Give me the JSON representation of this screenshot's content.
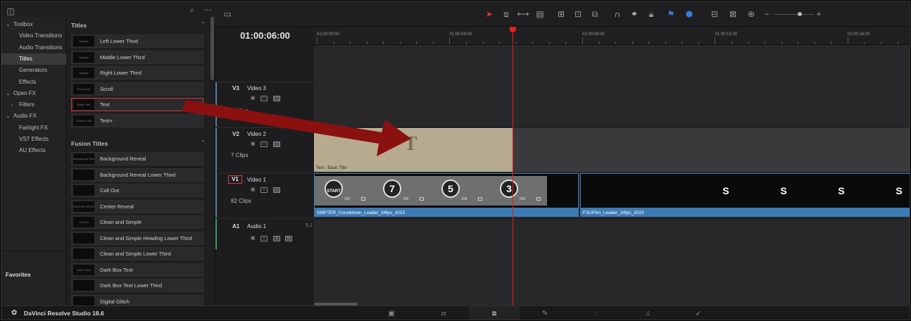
{
  "app": {
    "name": "DaVinci Resolve Studio 18.6",
    "accent": "#e03030"
  },
  "sidebar": {
    "items": [
      {
        "label": "Toolbox",
        "caret": "v",
        "indent": 0
      },
      {
        "label": "Video Transitions",
        "caret": "",
        "indent": 1
      },
      {
        "label": "Audio Transitions",
        "caret": "",
        "indent": 1
      },
      {
        "label": "Titles",
        "caret": "",
        "indent": 1,
        "selected": true
      },
      {
        "label": "Generators",
        "caret": "",
        "indent": 1
      },
      {
        "label": "Effects",
        "caret": "",
        "indent": 1
      },
      {
        "label": "Open FX",
        "caret": "v",
        "indent": 0
      },
      {
        "label": "Filters",
        "caret": ">",
        "indent": 1
      },
      {
        "label": "Audio FX",
        "caret": "v",
        "indent": 0
      },
      {
        "label": "Fairlight FX",
        "caret": "",
        "indent": 1
      },
      {
        "label": "VST Effects",
        "caret": "",
        "indent": 1
      },
      {
        "label": "AU Effects",
        "caret": "",
        "indent": 1
      }
    ],
    "favorites": "Favorites"
  },
  "effects_panel": {
    "titles_header": "Titles",
    "titles": [
      {
        "label": "Left Lower Third",
        "thumb": "Sample"
      },
      {
        "label": "Middle Lower Third",
        "thumb": "Sample"
      },
      {
        "label": "Right Lower Third",
        "thumb": "Sample"
      },
      {
        "label": "Scroll",
        "thumb": "Scroll Line"
      },
      {
        "label": "Text",
        "thumb": "Basic Title",
        "highlighted": true
      },
      {
        "label": "Text+",
        "thumb": "Custom Title"
      }
    ],
    "fusion_header": "Fusion Titles",
    "fusion": [
      {
        "label": "Background Reveal",
        "thumb": "Background Reveal"
      },
      {
        "label": "Background Reveal Lower Third",
        "thumb": ""
      },
      {
        "label": "Call Out",
        "thumb": ""
      },
      {
        "label": "Center Reveal",
        "thumb": "CENTER REVEAL"
      },
      {
        "label": "Clean and Simple",
        "thumb": "CLEAN"
      },
      {
        "label": "Clean and Simple Heading Lower Third",
        "thumb": ""
      },
      {
        "label": "Clean and Simple Lower Third",
        "thumb": ""
      },
      {
        "label": "Dark Box Text",
        "thumb": "DARK BOX"
      },
      {
        "label": "Dark Box Text Lower Third",
        "thumb": ""
      },
      {
        "label": "Digital Glitch",
        "thumb": ""
      }
    ]
  },
  "timeline": {
    "timecode": "01:00:06:00",
    "ruler": [
      "01:00:00:00",
      "01:00:04:00",
      "01:00:08:00",
      "01:00:12:00",
      "01:00:16:00"
    ],
    "tracks": [
      {
        "id": "V3",
        "name": "Video 3",
        "clips": "0 Clips"
      },
      {
        "id": "V2",
        "name": "Video 2",
        "clips": "7 Clips"
      },
      {
        "id": "V1",
        "name": "Video 1",
        "clips": "82 Clips"
      },
      {
        "id": "A1",
        "name": "Audio 1",
        "channels": "5.1"
      }
    ],
    "title_clip": {
      "glyph": "T",
      "label": "Text - Basic Title"
    },
    "v1_clips": [
      {
        "label": "SMPTER_Countdown_Leader_24fps_2023"
      },
      {
        "label": "FSUFilm_Leader_24fps_2023"
      }
    ],
    "countdown": [
      {
        "num": "",
        "sub": "192",
        "text": "START"
      },
      {
        "num": "7",
        "sub": "150"
      },
      {
        "num": "5",
        "sub": "108"
      },
      {
        "num": "3",
        "sub": "065"
      }
    ],
    "audio_buttons": {
      "solo": "S",
      "mute": "M"
    }
  }
}
